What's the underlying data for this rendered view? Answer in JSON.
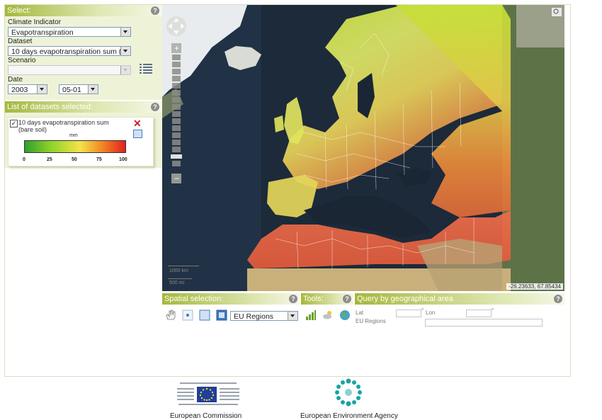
{
  "select_panel": {
    "title": "Select:",
    "climate_indicator_label": "Climate Indicator",
    "climate_indicator_value": "Evapotranspiration",
    "dataset_label": "Dataset",
    "dataset_value": "10 days evapotranspiration sum (b",
    "scenario_label": "Scenario",
    "scenario_value": "",
    "date_label": "Date",
    "year_value": "2003",
    "day_value": "05-01"
  },
  "datasets_panel": {
    "title": "List of datasets selected:",
    "item_name": "10 days evapotranspiration sum (bare soil)",
    "legend_unit": "mm",
    "legend_ticks": [
      "0",
      "25",
      "50",
      "75",
      "100"
    ]
  },
  "map": {
    "scale_km": "1000 km",
    "scale_mi": "500 mi",
    "coordinates": "-26.23633, 67.85434"
  },
  "spatial_selection": {
    "title": "Spatial selection:",
    "region_value": "EU Regions"
  },
  "tools": {
    "title": "Tools:"
  },
  "query": {
    "title": "Query by geographical area",
    "lat_label": "Lat",
    "lon_label": "Lon",
    "degree_symbol": "°",
    "eu_regions_label": "EU Regions"
  },
  "footer": {
    "ec_label": "European Commission",
    "eea_label": "European Environment Agency"
  }
}
